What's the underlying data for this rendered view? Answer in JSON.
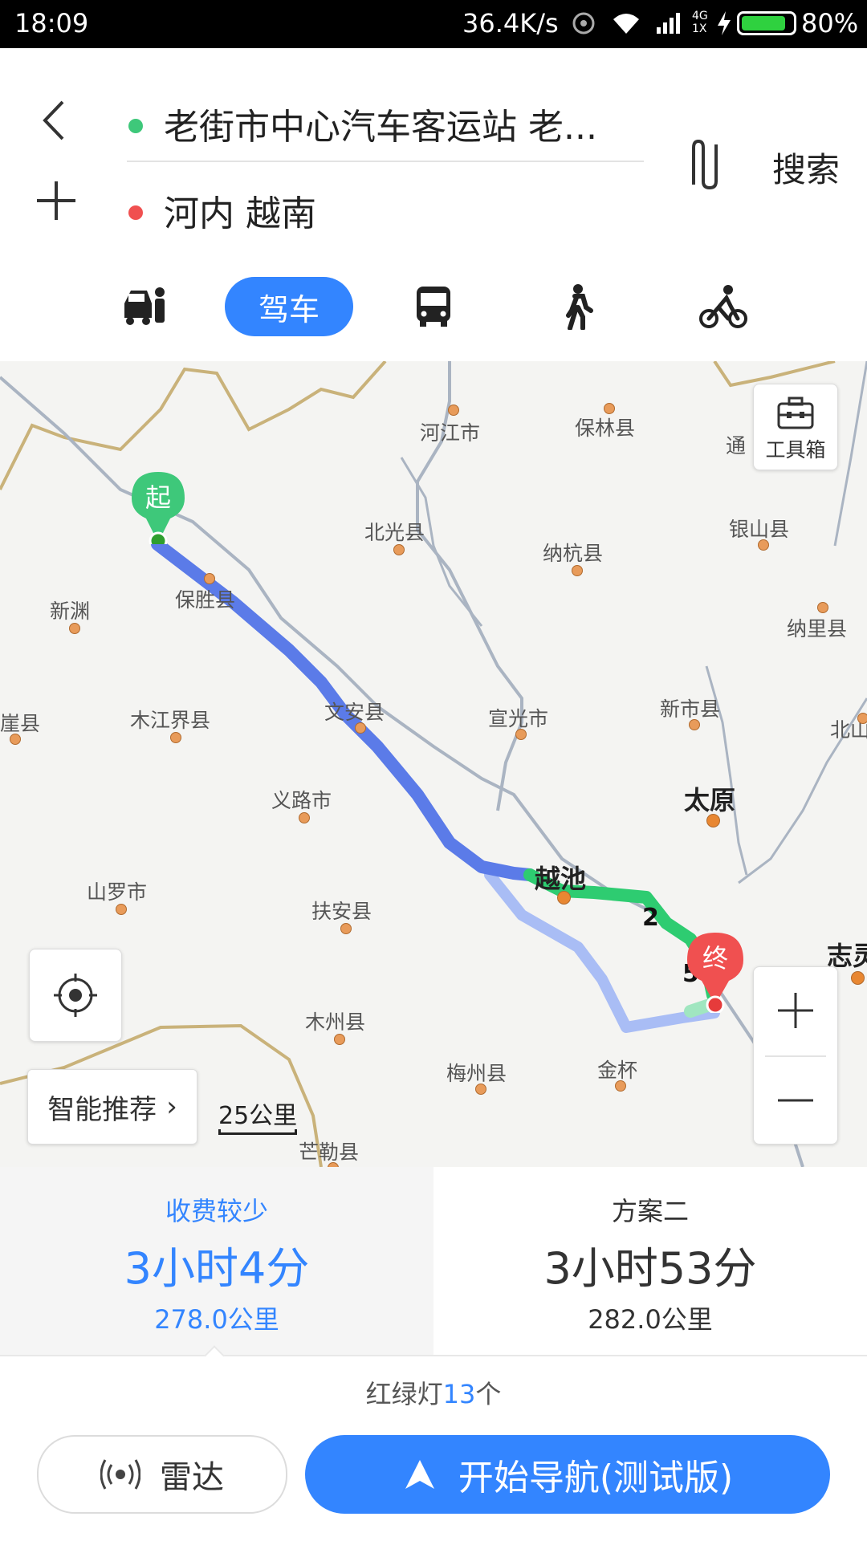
{
  "status_bar": {
    "time": "18:09",
    "speed": "36.4K/s",
    "network": "4G 1X",
    "battery": "80%",
    "battery_level": 0.8
  },
  "route": {
    "start": "老街市中心汽车客运站 老...",
    "end": "河内 越南",
    "start_color": "#3ec87a",
    "end_color": "#f05050",
    "search_label": "搜索"
  },
  "modes": {
    "taxi_icon": "taxi-icon",
    "drive_label": "驾车",
    "bus_icon": "bus-icon",
    "walk_icon": "walk-icon",
    "bike_icon": "bike-icon"
  },
  "map": {
    "toolbox_label": "工具箱",
    "recommend_label": "智能推荐",
    "scale_label": "25公里",
    "start_pin": "起",
    "end_pin": "终",
    "route_marker_2": "2",
    "route_marker_5": "5",
    "places": [
      "河江市",
      "保林县",
      "通",
      "北光县",
      "纳杭县",
      "银山县",
      "新渊",
      "保胜县",
      "纳里县",
      "崖县",
      "木江界县",
      "文安县",
      "宣光市",
      "新市县",
      "北山",
      "义路市",
      "太原",
      "越池",
      "山罗市",
      "扶安县",
      "志灵",
      "木州县",
      "梅州县",
      "金杯",
      "芒勒县"
    ]
  },
  "plans": [
    {
      "title": "收费较少",
      "time": "3小时4分",
      "distance": "278.0公里"
    },
    {
      "title": "方案二",
      "time": "3小时53分",
      "distance": "282.0公里"
    }
  ],
  "traffic_lights": {
    "prefix": "红绿灯",
    "count": "13",
    "suffix": "个"
  },
  "buttons": {
    "radar_label": "雷达",
    "navigate_label": "开始导航(测试版)"
  },
  "colors": {
    "accent": "#3385ff",
    "route_primary": "#5b7be8",
    "route_green": "#2ecc71",
    "route_alt": "#a9bdf5"
  }
}
